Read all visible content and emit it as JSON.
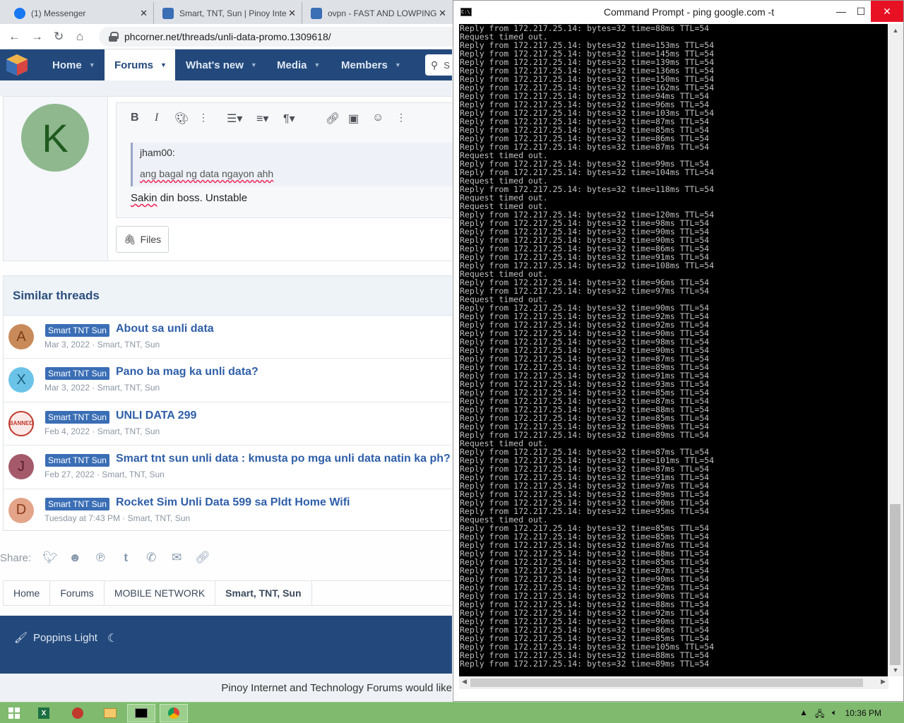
{
  "browser": {
    "tabs": [
      {
        "label": "(1) Messenger",
        "color": "#1877f2"
      },
      {
        "label": "Smart, TNT, Sun | Pinoy Inte",
        "color": "#3a6eb5"
      },
      {
        "label": "ovpn - FAST AND LOWPING",
        "color": "#3a6eb5"
      }
    ],
    "url": "phcorner.net/threads/unli-data-promo.1309618/"
  },
  "nav": {
    "items": [
      {
        "label": "Home"
      },
      {
        "label": "Forums"
      },
      {
        "label": "What's new"
      },
      {
        "label": "Media"
      },
      {
        "label": "Members"
      }
    ],
    "search_placeholder": "S"
  },
  "reply": {
    "avatar_letter": "K",
    "quote_author": "jham00:",
    "quote_text": "ang bagal ng data ngayon ahh",
    "text_word1": "Sakin",
    "text_rest": " din boss. Unstable",
    "files_label": "Files"
  },
  "similar": {
    "title": "Similar threads",
    "threads": [
      {
        "avatar": "A",
        "avatar_bg": "#c98a5a",
        "avatar_fg": "#7a3f14",
        "tag": "Smart TNT Sun",
        "title": "About sa unli data",
        "meta": "Mar 3, 2022 · Smart, TNT, Sun"
      },
      {
        "avatar": "X",
        "avatar_bg": "#6cc3e8",
        "avatar_fg": "#1b5f7d",
        "tag": "Smart TNT Sun",
        "title": "Pano ba mag ka unli data?",
        "meta": "Mar 3, 2022 · Smart, TNT, Sun"
      },
      {
        "avatar": "BANNED",
        "avatar_bg": "#fbe9e7",
        "avatar_fg": "#c0392b",
        "tag": "Smart TNT Sun",
        "title": "UNLI DATA 299",
        "meta": "Feb 4, 2022 · Smart, TNT, Sun"
      },
      {
        "avatar": "J",
        "avatar_bg": "#a45a6a",
        "avatar_fg": "#5a1f2b",
        "tag": "Smart TNT Sun",
        "title": "Smart tnt sun unli data : kmusta po mga unli data natin ka ph?",
        "meta": "Feb 27, 2022 · Smart, TNT, Sun"
      },
      {
        "avatar": "D",
        "avatar_bg": "#e3a48a",
        "avatar_fg": "#8a3b1a",
        "tag": "Smart TNT Sun",
        "title": "Rocket Sim Unli Data 599 sa Pldt Home Wifi",
        "meta": "Tuesday at 7:43 PM · Smart, TNT, Sun"
      }
    ]
  },
  "share_label": "Share:",
  "breadcrumbs": [
    "Home",
    "Forums",
    "MOBILE NETWORK",
    "Smart, TNT, Sun"
  ],
  "footer": {
    "style_label": "Poppins Light",
    "bottom_text": "Pinoy Internet and Technology Forums would like"
  },
  "cmd": {
    "title": "Command Prompt - ping  google.com -t",
    "lines": [
      "Reply from 172.217.25.14: bytes=32 time=88ms TTL=54",
      "Request timed out.",
      "Reply from 172.217.25.14: bytes=32 time=153ms TTL=54",
      "Reply from 172.217.25.14: bytes=32 time=145ms TTL=54",
      "Reply from 172.217.25.14: bytes=32 time=139ms TTL=54",
      "Reply from 172.217.25.14: bytes=32 time=136ms TTL=54",
      "Reply from 172.217.25.14: bytes=32 time=150ms TTL=54",
      "Reply from 172.217.25.14: bytes=32 time=162ms TTL=54",
      "Reply from 172.217.25.14: bytes=32 time=94ms TTL=54",
      "Reply from 172.217.25.14: bytes=32 time=96ms TTL=54",
      "Reply from 172.217.25.14: bytes=32 time=103ms TTL=54",
      "Reply from 172.217.25.14: bytes=32 time=87ms TTL=54",
      "Reply from 172.217.25.14: bytes=32 time=85ms TTL=54",
      "Reply from 172.217.25.14: bytes=32 time=86ms TTL=54",
      "Reply from 172.217.25.14: bytes=32 time=87ms TTL=54",
      "Request timed out.",
      "Reply from 172.217.25.14: bytes=32 time=99ms TTL=54",
      "Reply from 172.217.25.14: bytes=32 time=104ms TTL=54",
      "Request timed out.",
      "Reply from 172.217.25.14: bytes=32 time=118ms TTL=54",
      "Request timed out.",
      "Request timed out.",
      "Reply from 172.217.25.14: bytes=32 time=120ms TTL=54",
      "Reply from 172.217.25.14: bytes=32 time=98ms TTL=54",
      "Reply from 172.217.25.14: bytes=32 time=90ms TTL=54",
      "Reply from 172.217.25.14: bytes=32 time=90ms TTL=54",
      "Reply from 172.217.25.14: bytes=32 time=86ms TTL=54",
      "Reply from 172.217.25.14: bytes=32 time=91ms TTL=54",
      "Reply from 172.217.25.14: bytes=32 time=108ms TTL=54",
      "Request timed out.",
      "Reply from 172.217.25.14: bytes=32 time=96ms TTL=54",
      "Reply from 172.217.25.14: bytes=32 time=97ms TTL=54",
      "Request timed out.",
      "Reply from 172.217.25.14: bytes=32 time=90ms TTL=54",
      "Reply from 172.217.25.14: bytes=32 time=92ms TTL=54",
      "Reply from 172.217.25.14: bytes=32 time=92ms TTL=54",
      "Reply from 172.217.25.14: bytes=32 time=90ms TTL=54",
      "Reply from 172.217.25.14: bytes=32 time=98ms TTL=54",
      "Reply from 172.217.25.14: bytes=32 time=90ms TTL=54",
      "Reply from 172.217.25.14: bytes=32 time=87ms TTL=54",
      "Reply from 172.217.25.14: bytes=32 time=89ms TTL=54",
      "Reply from 172.217.25.14: bytes=32 time=91ms TTL=54",
      "Reply from 172.217.25.14: bytes=32 time=93ms TTL=54",
      "Reply from 172.217.25.14: bytes=32 time=85ms TTL=54",
      "Reply from 172.217.25.14: bytes=32 time=87ms TTL=54",
      "Reply from 172.217.25.14: bytes=32 time=88ms TTL=54",
      "Reply from 172.217.25.14: bytes=32 time=85ms TTL=54",
      "Reply from 172.217.25.14: bytes=32 time=89ms TTL=54",
      "Reply from 172.217.25.14: bytes=32 time=89ms TTL=54",
      "Request timed out.",
      "Reply from 172.217.25.14: bytes=32 time=87ms TTL=54",
      "Reply from 172.217.25.14: bytes=32 time=101ms TTL=54",
      "Reply from 172.217.25.14: bytes=32 time=87ms TTL=54",
      "Reply from 172.217.25.14: bytes=32 time=91ms TTL=54",
      "Reply from 172.217.25.14: bytes=32 time=97ms TTL=54",
      "Reply from 172.217.25.14: bytes=32 time=89ms TTL=54",
      "Reply from 172.217.25.14: bytes=32 time=90ms TTL=54",
      "Reply from 172.217.25.14: bytes=32 time=95ms TTL=54",
      "Request timed out.",
      "Reply from 172.217.25.14: bytes=32 time=85ms TTL=54",
      "Reply from 172.217.25.14: bytes=32 time=85ms TTL=54",
      "Reply from 172.217.25.14: bytes=32 time=87ms TTL=54",
      "Reply from 172.217.25.14: bytes=32 time=88ms TTL=54",
      "Reply from 172.217.25.14: bytes=32 time=85ms TTL=54",
      "Reply from 172.217.25.14: bytes=32 time=87ms TTL=54",
      "Reply from 172.217.25.14: bytes=32 time=90ms TTL=54",
      "Reply from 172.217.25.14: bytes=32 time=92ms TTL=54",
      "Reply from 172.217.25.14: bytes=32 time=90ms TTL=54",
      "Reply from 172.217.25.14: bytes=32 time=88ms TTL=54",
      "Reply from 172.217.25.14: bytes=32 time=92ms TTL=54",
      "Reply from 172.217.25.14: bytes=32 time=90ms TTL=54",
      "Reply from 172.217.25.14: bytes=32 time=86ms TTL=54",
      "Reply from 172.217.25.14: bytes=32 time=85ms TTL=54",
      "Reply from 172.217.25.14: bytes=32 time=105ms TTL=54",
      "Reply from 172.217.25.14: bytes=32 time=88ms TTL=54",
      "Reply from 172.217.25.14: bytes=32 time=89ms TTL=54"
    ]
  },
  "taskbar": {
    "clock": "10:36 PM"
  },
  "colors": {
    "nav_bg": "#23497c",
    "tag_bg": "#3a6eb5",
    "thread_link": "#2e5ea8",
    "taskbar": "#7fba6e",
    "close_red": "#e81123"
  }
}
